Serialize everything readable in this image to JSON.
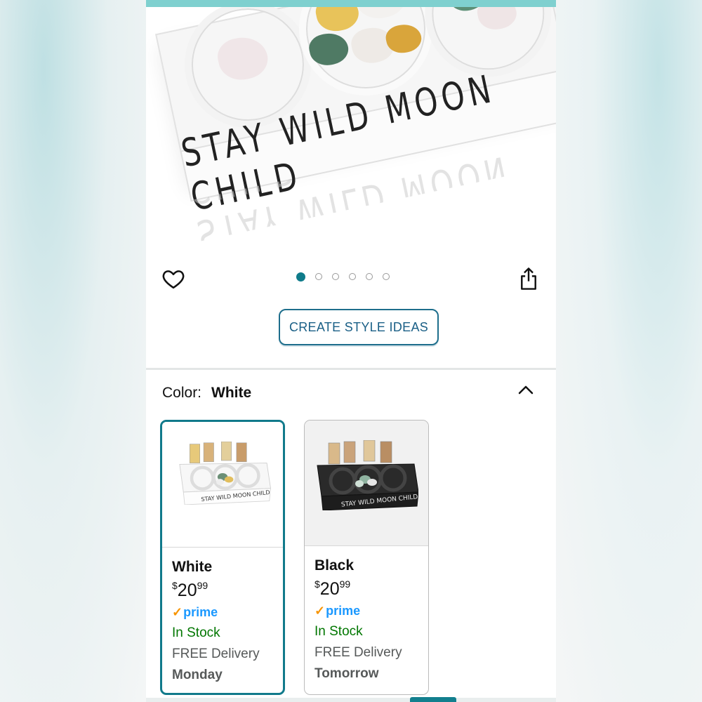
{
  "hero": {
    "engraving": "STAY WILD MOON CHILD",
    "carousel": {
      "count": 6,
      "active_index": 0
    }
  },
  "actions": {
    "style_ideas_label": "CREATE STYLE IDEAS"
  },
  "color_selector": {
    "label": "Color:",
    "selected_value": "White",
    "options": [
      {
        "name": "White",
        "price": {
          "currency": "$",
          "whole": "20",
          "fraction": "99"
        },
        "prime": "prime",
        "stock": "In Stock",
        "delivery_label": "FREE Delivery",
        "delivery_day": "Monday",
        "selected": true
      },
      {
        "name": "Black",
        "price": {
          "currency": "$",
          "whole": "20",
          "fraction": "99"
        },
        "prime": "prime",
        "stock": "In Stock",
        "delivery_label": "FREE Delivery",
        "delivery_day": "Tomorrow",
        "selected": false
      }
    ]
  },
  "colors": {
    "accent": "#117a8b",
    "link": "#1a5f86",
    "in_stock": "#007600",
    "prime_blue": "#1a98ff",
    "prime_check": "#f79400"
  },
  "icons": {
    "favorite": "heart-icon",
    "share": "share-icon",
    "collapse": "chevron-up-icon"
  }
}
